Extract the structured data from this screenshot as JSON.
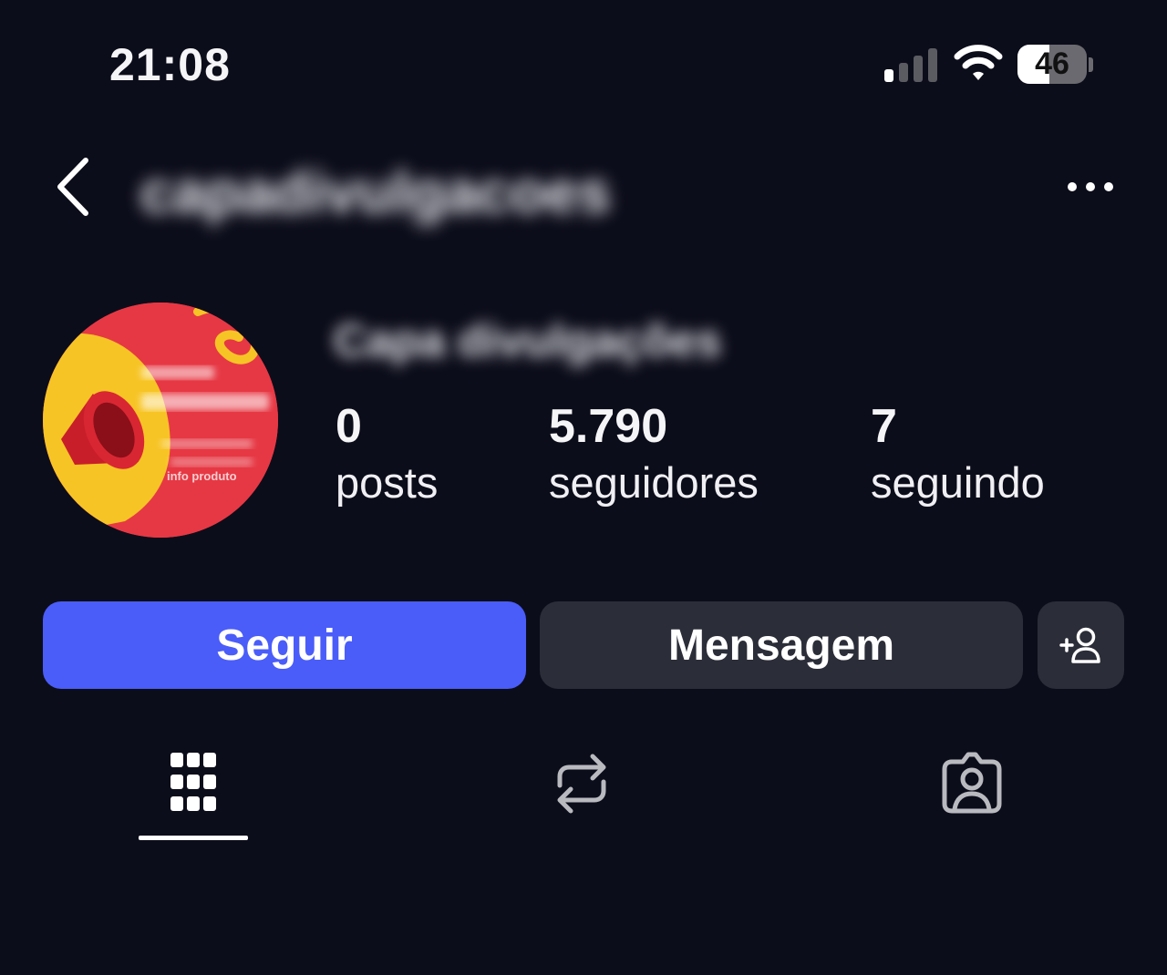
{
  "status_bar": {
    "time": "21:08",
    "battery": "46",
    "battery_level": 0.46,
    "icons": [
      "cellular-signal-icon",
      "wifi-icon",
      "battery-icon"
    ]
  },
  "header": {
    "back_icon": "chevron-left-icon",
    "username": "capadivulgacoes",
    "more_icon": "more-horizontal-icon"
  },
  "profile": {
    "avatar_caption": "info produto",
    "display_name": "Capa divulgações",
    "stats": {
      "posts": {
        "count": "0",
        "label": "posts"
      },
      "followers": {
        "count": "5.790",
        "label": "seguidores"
      },
      "following": {
        "count": "7",
        "label": "seguindo"
      }
    }
  },
  "actions": {
    "follow_label": "Seguir",
    "message_label": "Mensagem",
    "add_user_icon": "add-user-icon"
  },
  "tabs": [
    {
      "name": "grid",
      "icon": "grid-icon",
      "active": true
    },
    {
      "name": "reposts",
      "icon": "repost-icon",
      "active": false
    },
    {
      "name": "tagged",
      "icon": "tagged-person-icon",
      "active": false
    }
  ],
  "colors": {
    "background": "#0c0d1a",
    "follow_button": "#4a5df9",
    "secondary_button": "#2b2d38",
    "avatar_red": "#e63844",
    "avatar_yellow": "#f7c425"
  }
}
